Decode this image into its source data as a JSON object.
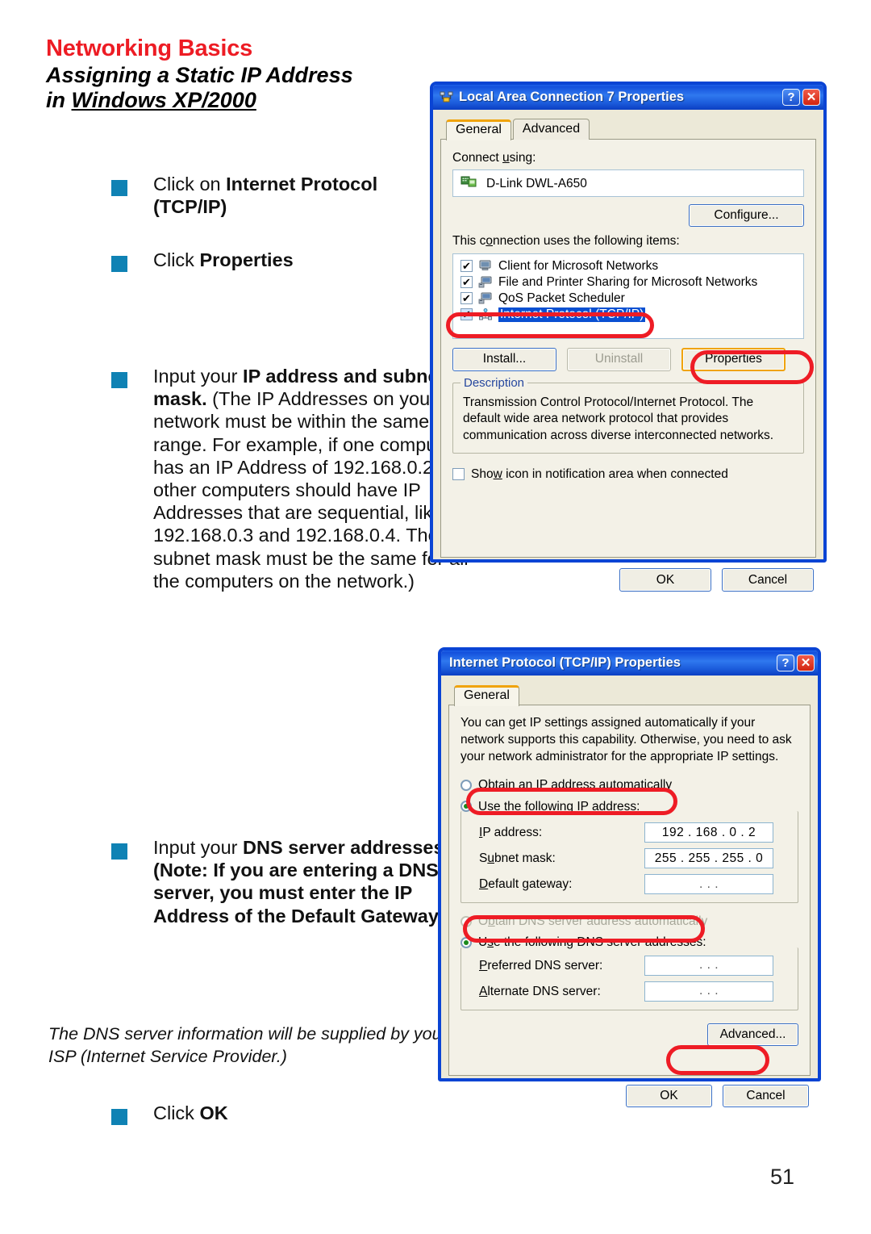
{
  "page": {
    "kicker": "Networking Basics",
    "subtitle_line1": "Assigning a Static IP Address",
    "subtitle_line2_pre": "in ",
    "subtitle_line2_underlined": "Windows XP/2000",
    "page_number": "51",
    "note_italic": "The DNS server information will be supplied by your ISP (Internet Service Provider.)"
  },
  "instructions": [
    {
      "id": "click-internet-protocol",
      "plain1": "Click on ",
      "bold1": "Internet Protocol (TCP/IP)",
      "plain2": ""
    },
    {
      "id": "click-properties",
      "plain1": "Click ",
      "bold1": "Properties",
      "plain2": ""
    },
    {
      "id": "input-ip-address",
      "plain1": "Input your ",
      "bold1": "IP address and subnet mask.",
      "plain2": " (The IP Addresses on your network must be within the same range. For example, if one computer has an IP Address of 192.168.0.2, the other computers should have IP Addresses that are sequential, like 192.168.0.3 and 192.168.0.4. The subnet mask must be the same for all the computers on the network.)"
    },
    {
      "id": "input-dns-server",
      "plain1": "Input your ",
      "bold1": "DNS server addresses. (Note:  If you are entering a DNS server, you must enter the IP Address of the Default Gateway.)",
      "plain2": ""
    },
    {
      "id": "click-ok",
      "plain1": "Click ",
      "bold1": "OK",
      "plain2": ""
    }
  ],
  "dialog_lan": {
    "title": "Local Area Connection 7 Properties",
    "help_btn": "?",
    "close_btn": "✕",
    "tabs": [
      {
        "label": "General",
        "active": true
      },
      {
        "label": "Advanced",
        "active": false
      }
    ],
    "connect_using_label": "Connect using:",
    "adapter_name": "D-Link DWL-A650",
    "configure_button": "Configure...",
    "items_label": "This connection uses the following items:",
    "items": [
      {
        "label": "Client for Microsoft Networks",
        "checked": true,
        "selected": false
      },
      {
        "label": "File and Printer Sharing for Microsoft Networks",
        "checked": true,
        "selected": false
      },
      {
        "label": "QoS Packet Scheduler",
        "checked": true,
        "selected": false
      },
      {
        "label": "Internet Protocol (TCP/IP)",
        "checked": true,
        "selected": true
      }
    ],
    "install_button": "Install...",
    "uninstall_button": "Uninstall",
    "properties_button": "Properties",
    "description_title": "Description",
    "description_text": "Transmission Control Protocol/Internet Protocol. The default wide area network protocol that provides communication across diverse interconnected networks.",
    "show_icon_checkbox": "Show icon in notification area when connected",
    "show_icon_checked": false,
    "ok_button": "OK",
    "cancel_button": "Cancel"
  },
  "dialog_tcpip": {
    "title": "Internet Protocol (TCP/IP) Properties",
    "help_btn": "?",
    "close_btn": "✕",
    "tabs": [
      {
        "label": "General",
        "active": true
      }
    ],
    "intro_text": "You can get IP settings assigned automatically if your network supports this capability. Otherwise, you need to ask your network administrator for the appropriate IP settings.",
    "radio_obtain_ip": "Obtain an IP address automatically",
    "radio_use_ip": "Use the following IP address:",
    "ip_address_label": "IP address:",
    "ip_address_value": "192 . 168 .   0  .   2",
    "subnet_mask_label": "Subnet mask:",
    "subnet_mask_value": "255 . 255 . 255 .   0",
    "default_gateway_label": "Default gateway:",
    "default_gateway_value": ".      .      .",
    "radio_obtain_dns": "Obtain DNS server address automatically",
    "radio_use_dns": "Use the following DNS server addresses:",
    "preferred_dns_label": "Preferred DNS server:",
    "preferred_dns_value": ".      .      .",
    "alternate_dns_label": "Alternate DNS server:",
    "alternate_dns_value": ".      .      .",
    "advanced_button": "Advanced...",
    "ok_button": "OK",
    "cancel_button": "Cancel"
  },
  "colors": {
    "kicker_red": "#ed1c24",
    "bullet_teal": "#0f82b4",
    "annotation_red": "#ee1c25",
    "titlebar_blue": "#1450dc",
    "selection_blue": "#0a50d2",
    "dialog_face": "#ece9d8"
  }
}
